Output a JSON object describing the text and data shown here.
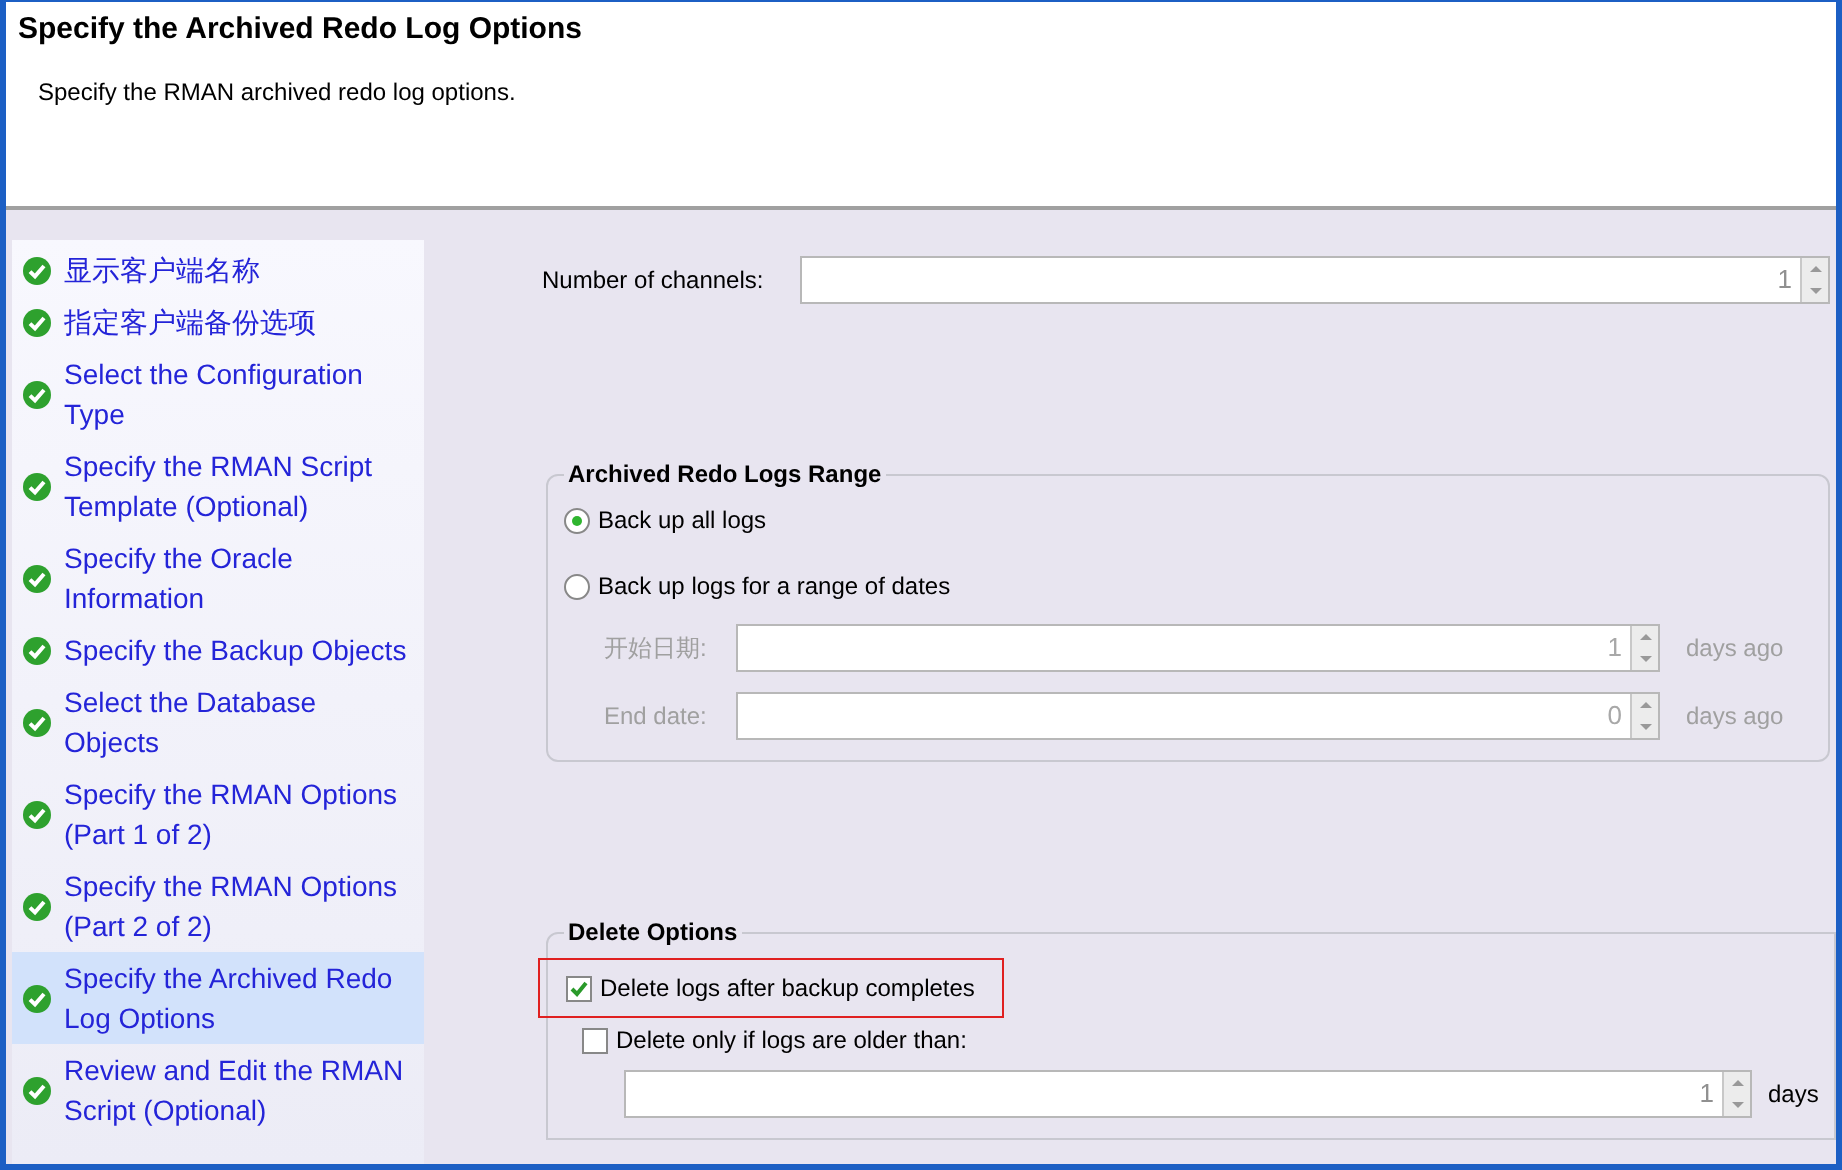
{
  "window": {
    "title": "Specify the Archived Redo Log Options",
    "subtitle": "Specify the RMAN archived redo log options."
  },
  "steps": [
    {
      "label": "显示客户端名称",
      "selected": false,
      "completed": true
    },
    {
      "label": "指定客户端备份选项",
      "selected": false,
      "completed": true
    },
    {
      "label": "Select the Configuration Type",
      "selected": false,
      "completed": true
    },
    {
      "label": "Specify the RMAN Script Template (Optional)",
      "selected": false,
      "completed": true
    },
    {
      "label": "Specify the Oracle Information",
      "selected": false,
      "completed": true
    },
    {
      "label": "Specify the Backup Objects",
      "selected": false,
      "completed": true
    },
    {
      "label": "Select the Database Objects",
      "selected": false,
      "completed": true
    },
    {
      "label": "Specify the RMAN Options (Part 1 of 2)",
      "selected": false,
      "completed": true
    },
    {
      "label": "Specify the RMAN Options (Part 2 of 2)",
      "selected": false,
      "completed": true
    },
    {
      "label": "Specify the Archived Redo Log Options",
      "selected": true,
      "completed": true
    },
    {
      "label": "Review and Edit the RMAN Script (Optional)",
      "selected": false,
      "completed": true
    }
  ],
  "channels": {
    "label": "Number of channels:",
    "value": "1"
  },
  "range": {
    "title": "Archived Redo Logs Range",
    "options": [
      {
        "label": "Back up all logs",
        "selected": true
      },
      {
        "label": "Back up logs for a range of dates",
        "selected": false
      }
    ],
    "fields": [
      {
        "label": "开始日期:",
        "value": "1",
        "unit": "days ago",
        "disabled": true
      },
      {
        "label": "End date:",
        "value": "0",
        "unit": "days ago",
        "disabled": true
      }
    ]
  },
  "delete": {
    "title": "Delete Options",
    "options": [
      {
        "label": "Delete logs after backup completes",
        "checked": true,
        "highlighted": true
      },
      {
        "label": "Delete only if logs are older than:",
        "checked": false,
        "highlighted": false
      }
    ],
    "field": {
      "value": "1",
      "unit": "days"
    }
  }
}
